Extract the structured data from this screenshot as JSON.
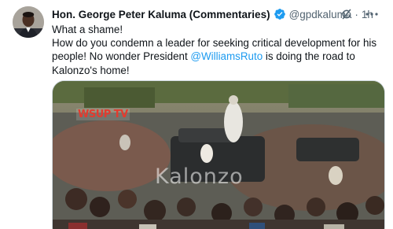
{
  "tweet": {
    "display_name": "Hon. George Peter Kaluma (Commentaries)",
    "handle": "@gpdkaluma",
    "separator": "·",
    "time": "1h",
    "icons": {
      "verified": "verified-badge-icon",
      "grok": "grok-icon",
      "more": "more-options-icon"
    },
    "text": {
      "line1": "What a shame!",
      "line2_before": "How do you condemn a leader for seeking critical development for his people! No wonder President ",
      "mention": "@WilliamsRuto",
      "line2_after": " is doing the road to Kalonzo's home!"
    },
    "media": {
      "watermark": "Kalonzo",
      "logo": "WSUP TV"
    }
  },
  "colors": {
    "accent": "#1d9bf0",
    "text_primary": "#0f1419",
    "text_secondary": "#536471",
    "border": "#cfd9de"
  }
}
